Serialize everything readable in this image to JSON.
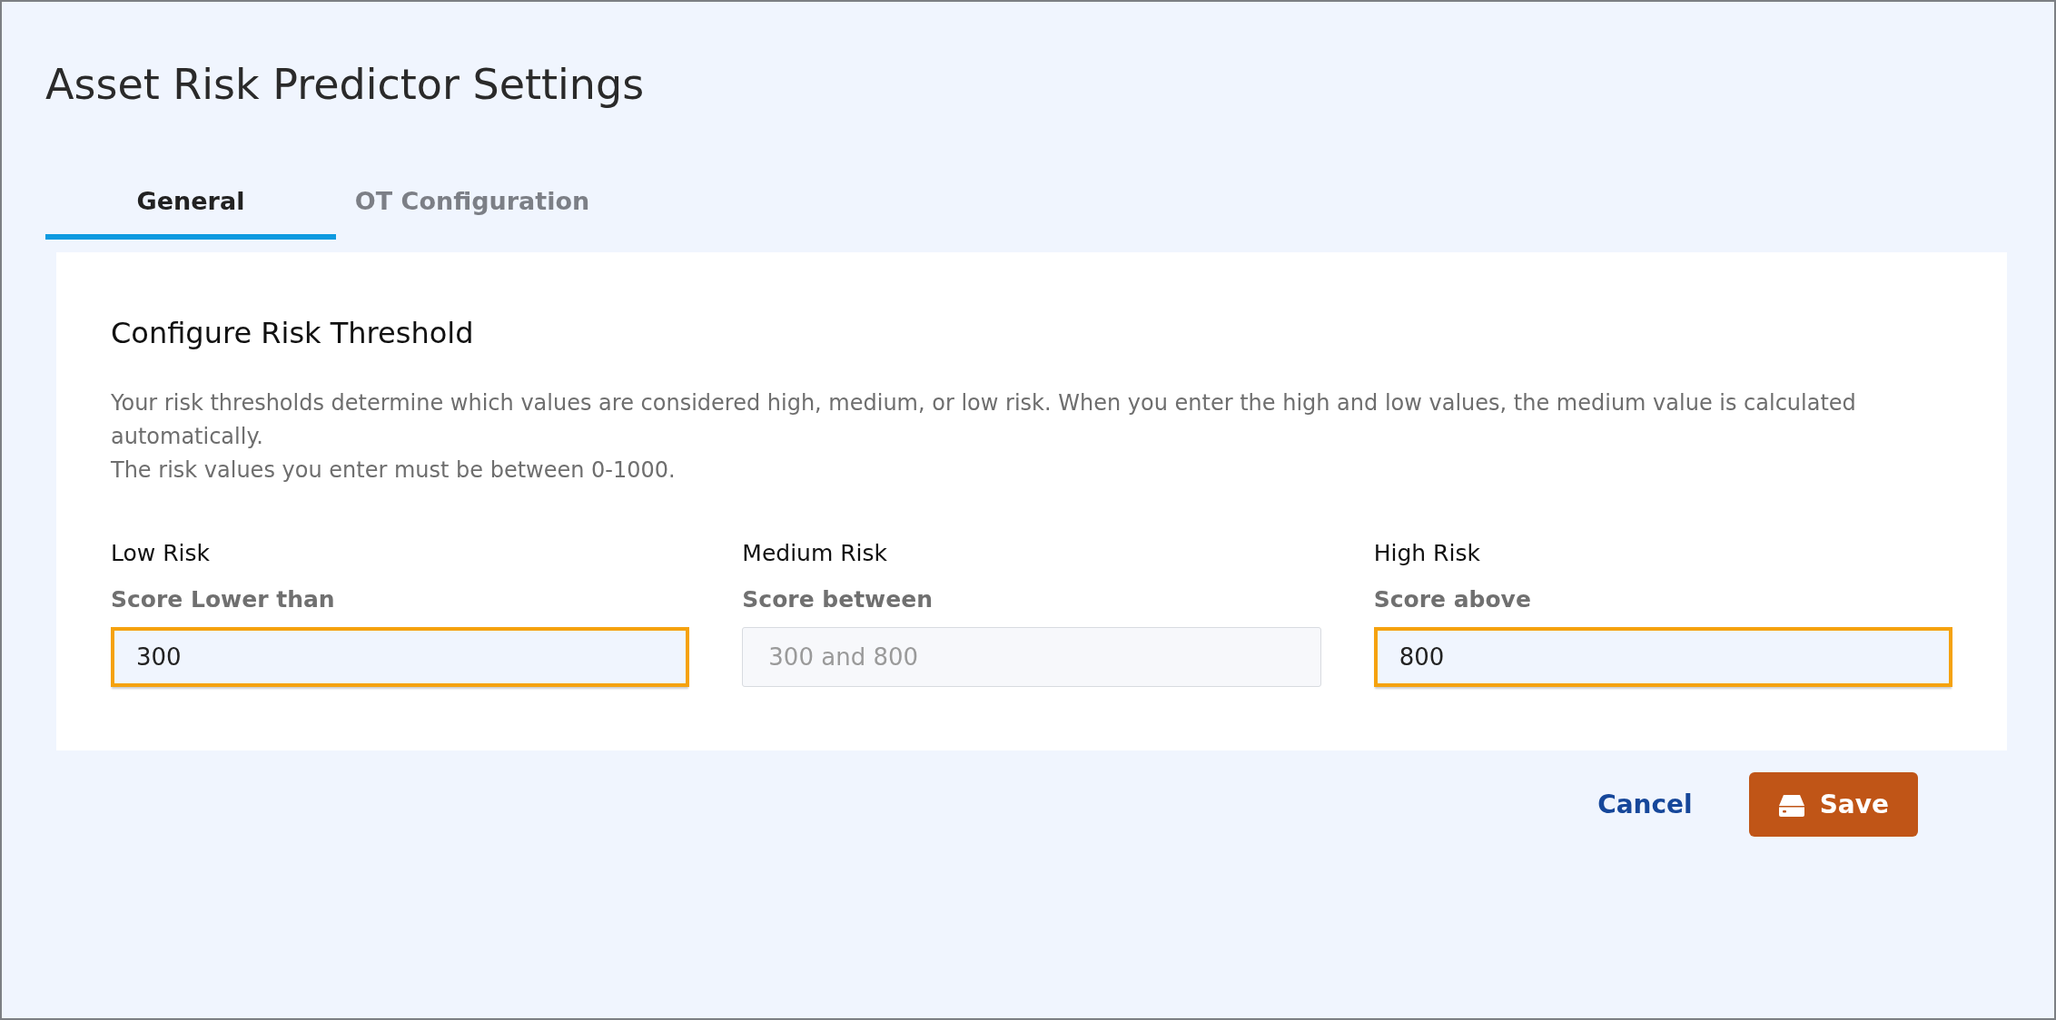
{
  "window": {
    "title": "Asset Risk Predictor Settings"
  },
  "tabs": [
    {
      "label": "General",
      "selected": true
    },
    {
      "label": "OT Configuration",
      "selected": false
    }
  ],
  "section": {
    "heading": "Configure Risk Threshold",
    "description": [
      "Your risk thresholds determine which values are considered high, medium, or low risk. When you enter the high and low values, the medium value is calculated automatically.",
      "The risk values you enter must be between 0-1000."
    ],
    "fields": [
      {
        "label": "Low Risk",
        "sublabel": "Score Lower than",
        "value": "300",
        "disabled": false,
        "highlighted": true
      },
      {
        "label": "Medium Risk",
        "sublabel": "Score between",
        "value": "300 and 800",
        "disabled": true,
        "highlighted": false
      },
      {
        "label": "High Risk",
        "sublabel": "Score above",
        "value": "800",
        "disabled": false,
        "highlighted": true
      }
    ]
  },
  "buttons": [
    {
      "kind": "link",
      "label": "Cancel"
    },
    {
      "kind": "primary",
      "label": "Save"
    }
  ]
}
